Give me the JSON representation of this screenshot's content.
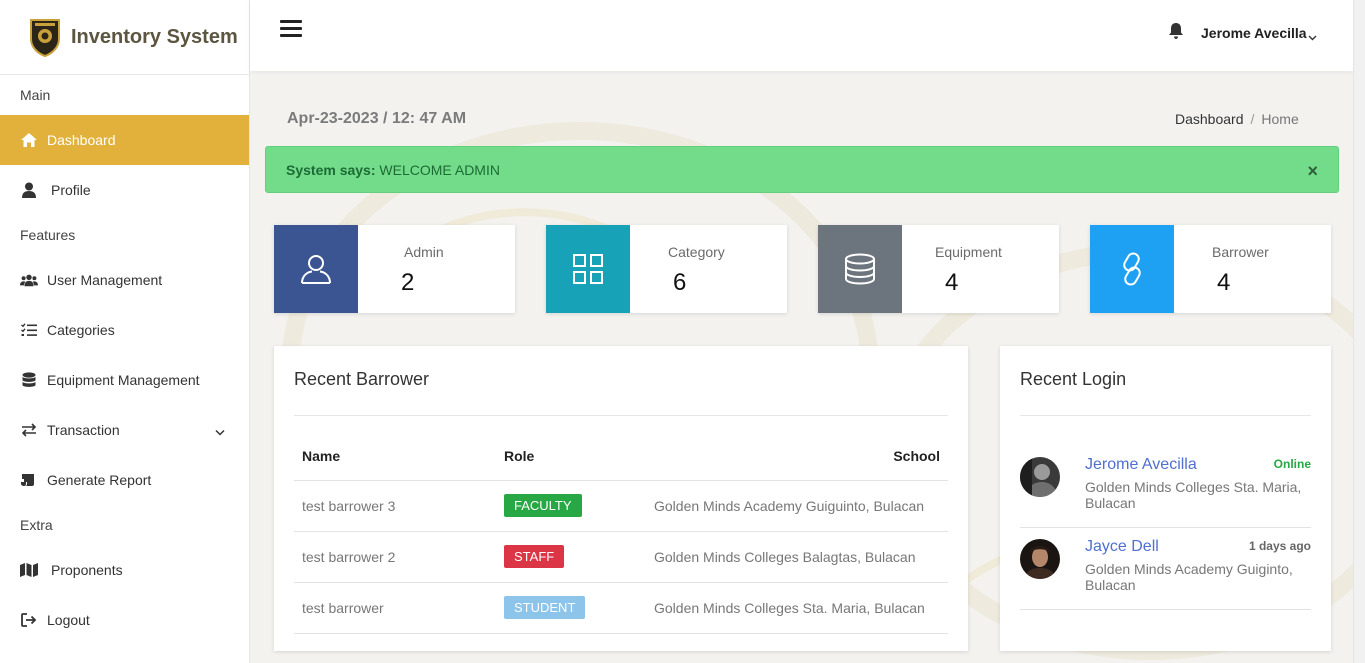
{
  "app": {
    "title": "Inventory System"
  },
  "sidebar": {
    "sections": [
      {
        "label": "Main"
      },
      {
        "label": "Features"
      },
      {
        "label": "Extra"
      }
    ],
    "items": [
      {
        "label": "Dashboard",
        "icon": "home-icon"
      },
      {
        "label": "Profile",
        "icon": "user-icon"
      },
      {
        "label": "User Management",
        "icon": "users-icon"
      },
      {
        "label": "Categories",
        "icon": "list-check-icon"
      },
      {
        "label": "Equipment Management",
        "icon": "database-icon"
      },
      {
        "label": "Transaction",
        "icon": "exchange-icon"
      },
      {
        "label": "Generate Report",
        "icon": "report-icon"
      },
      {
        "label": "Proponents",
        "icon": "map-icon"
      },
      {
        "label": "Logout",
        "icon": "logout-icon"
      }
    ]
  },
  "topbar": {
    "username": "Jerome Avecilla"
  },
  "header": {
    "datetime": "Apr-23-2023 / 12: 47 AM",
    "breadcrumb": [
      "Dashboard",
      "Home"
    ]
  },
  "alert": {
    "prefix": "System says:",
    "message": "WELCOME ADMIN",
    "close": "×"
  },
  "stats": [
    {
      "label": "Admin",
      "value": "2",
      "color": "#3b5592",
      "icon": "user-outline-icon"
    },
    {
      "label": "Category",
      "value": "6",
      "color": "#17a2b8",
      "icon": "grid-icon"
    },
    {
      "label": "Equipment",
      "value": "4",
      "color": "#6c757d",
      "icon": "database-icon"
    },
    {
      "label": "Barrower",
      "value": "4",
      "color": "#1ea1f2",
      "icon": "link-icon"
    }
  ],
  "recent_barrower": {
    "title": "Recent Barrower",
    "columns": [
      "Name",
      "Role",
      "School"
    ],
    "rows": [
      {
        "name": "test barrower 3",
        "role": "FACULTY",
        "role_color": "#28a745",
        "school": "Golden Minds Academy Guiguinto, Bulacan"
      },
      {
        "name": "test barrower 2",
        "role": "STAFF",
        "role_color": "#dc3545",
        "school": "Golden Minds Colleges Balagtas, Bulacan"
      },
      {
        "name": "test barrower",
        "role": "STUDENT",
        "role_color": "#8cc4ea",
        "school": "Golden Minds Colleges Sta. Maria, Bulacan"
      }
    ]
  },
  "recent_login": {
    "title": "Recent Login",
    "entries": [
      {
        "name": "Jerome Avecilla",
        "status": "Online",
        "status_color": "#28a745",
        "school": "Golden Minds Colleges Sta. Maria, Bulacan"
      },
      {
        "name": "Jayce Dell",
        "status": "1 days ago",
        "status_color": "#666666",
        "school": "Golden Minds Academy Guiginto, Bulacan"
      }
    ]
  }
}
